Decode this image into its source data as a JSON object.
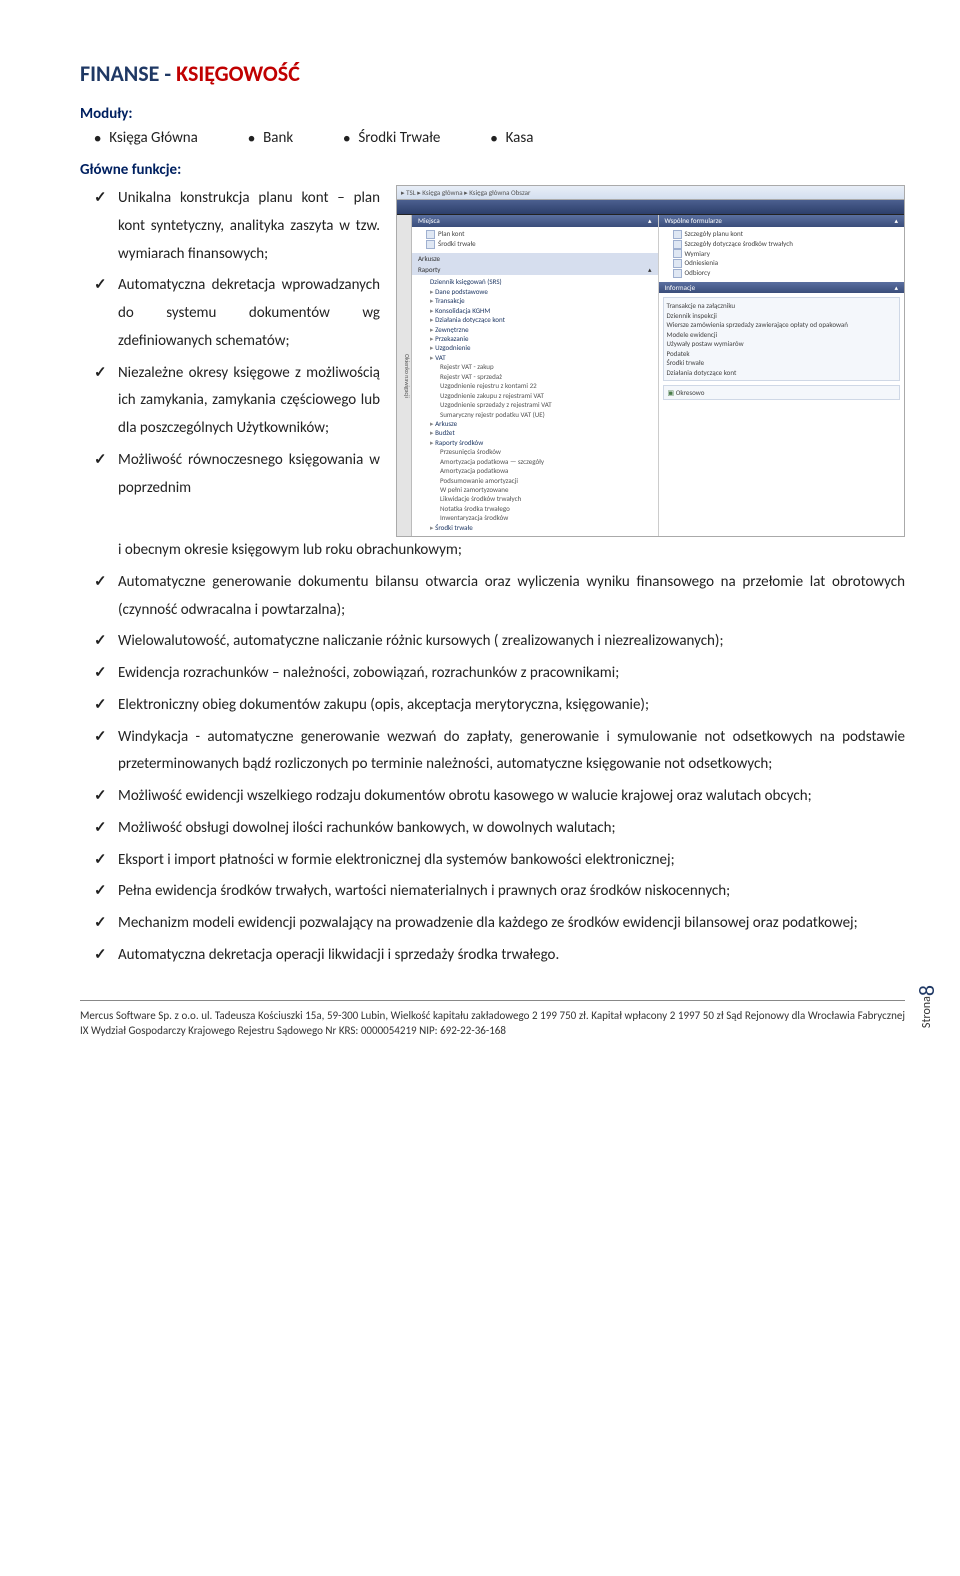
{
  "title_part1": "FINANSE - ",
  "title_part2": "KSIĘGOWOŚĆ",
  "label_moduly": "Moduły:",
  "modules": [
    "Księga Główna",
    "Bank",
    "Środki Trwałe",
    "Kasa"
  ],
  "label_funkcje": "Główne funkcje:",
  "left_features": [
    "Unikalna konstrukcja planu kont – plan kont syntetyczny, analityka zaszyta w tzw. wymiarach finansowych;",
    "Automatyczna dekretacja wprowadzanych do systemu dokumentów wg zdefiniowanych schematów;",
    "Niezależne okresy księgowe z możliwością ich zamykania, zamykania częściowego lub dla poszczególnych Użytkowników;",
    "Możliwość równoczesnego księgowania w poprzednim"
  ],
  "full_features": [
    "i obecnym okresie księgowym lub roku obrachunkowym;",
    "Automatyczne generowanie dokumentu bilansu otwarcia oraz wyliczenia wyniku finansowego na przełomie lat obrotowych (czynność odwracalna i powtarzalna);",
    "Wielowalutowość, automatyczne naliczanie różnic kursowych ( zrealizowanych i niezrealizowanych);",
    "Ewidencja rozrachunków – należności, zobowiązań, rozrachunków z pracownikami;",
    "Elektroniczny obieg dokumentów zakupu (opis, akceptacja merytoryczna, księgowanie);",
    "Windykacja - automatyczne generowanie wezwań do zapłaty, generowanie i symulowanie not odsetkowych na podstawie przeterminowanych bądź rozliczonych po terminie należności, automatyczne księgowanie not odsetkowych;",
    "Możliwość ewidencji wszelkiego rodzaju dokumentów obrotu kasowego w walucie krajowej oraz walutach obcych;",
    "Możliwość obsługi dowolnej ilości rachunków bankowych, w dowolnych walutach;",
    "Eksport i import płatności w formie elektronicznej dla systemów bankowości elektronicznej;",
    "Pełna ewidencja środków trwałych, wartości niematerialnych i prawnych oraz środków niskocennych;",
    "Mechanizm modeli ewidencji pozwalający na prowadzenie dla każdego ze środków ewidencji bilansowej oraz podatkowej;",
    "Automatyczna dekretacja operacji likwidacji i sprzedaży środka trwałego."
  ],
  "shot": {
    "breadcrumb": "▸ TSL ▸ Księga główna ▸ Księga główna Obszar",
    "tab": "Okienko nawigacji",
    "col1": {
      "hdr": "Miejsca",
      "items": [
        "Plan kont",
        "Środki trwałe"
      ],
      "arkusze": "Arkusze",
      "raporty": "Raporty",
      "tree": [
        {
          "t": "Dziennik księgowań (SRS)",
          "lvl": 1
        },
        {
          "t": "Dane podstawowe",
          "lvl": 1,
          "doc": true
        },
        {
          "t": "Transakcje",
          "lvl": 1,
          "doc": true
        },
        {
          "t": "Konsolidacja KGHM",
          "lvl": 1,
          "doc": true
        },
        {
          "t": "Działania dotyczące kont",
          "lvl": 1,
          "doc": true
        },
        {
          "t": "Zewnętrzne",
          "lvl": 1,
          "doc": true
        },
        {
          "t": "Przekazanie",
          "lvl": 1,
          "doc": true
        },
        {
          "t": "Uzgodnienie",
          "lvl": 1,
          "doc": true
        },
        {
          "t": "VAT",
          "lvl": 1,
          "doc": true
        },
        {
          "t": "Rejestr VAT - zakup",
          "lvl": 2
        },
        {
          "t": "Rejestr VAT - sprzedaż",
          "lvl": 2
        },
        {
          "t": "Uzgodnienie rejestru z kontami 22",
          "lvl": 2
        },
        {
          "t": "Uzgodnienie zakupu z rejestrami VAT",
          "lvl": 2
        },
        {
          "t": "Uzgodnienie sprzedaży z rejestrami VAT",
          "lvl": 2
        },
        {
          "t": "Sumaryczny rejestr podatku VAT (UE)",
          "lvl": 2
        },
        {
          "t": "Arkusze",
          "lvl": 1,
          "doc": true
        },
        {
          "t": "Budżet",
          "lvl": 1,
          "doc": true
        },
        {
          "t": "Raporty środków",
          "lvl": 1,
          "doc": true
        },
        {
          "t": "Przesunięcia środków",
          "lvl": 2
        },
        {
          "t": "Amortyzacja podatkowa — szczegóły",
          "lvl": 2
        },
        {
          "t": "Amortyzacja podatkowa",
          "lvl": 2
        },
        {
          "t": "Podsumowanie amortyzacji",
          "lvl": 2
        },
        {
          "t": "W pełni zamortyzowane",
          "lvl": 2
        },
        {
          "t": "Likwidacje środków trwałych",
          "lvl": 2
        },
        {
          "t": "Notatka środka trwałego",
          "lvl": 2
        },
        {
          "t": "Inwentaryzacja środków",
          "lvl": 2
        },
        {
          "t": "Środki trwałe",
          "lvl": 1,
          "doc": true
        }
      ]
    },
    "col2": {
      "hdr": "Wspólne formularze",
      "items": [
        "Szczegóły planu kont",
        "Szczegóły dotyczące środków trwałych",
        "Wymiary",
        "Odniesienia",
        "Odbiorcy"
      ],
      "info_hdr": "Informacje",
      "info": [
        "Transakcje na załączniku",
        "Dziennik inspekcji",
        "Wiersze zamówienia sprzedaży zawierające opłaty od opakowań",
        "Modele ewidencji",
        "Używały postaw wymiarów",
        "Podatek",
        "Środki trwałe",
        "Działania dotyczące kont"
      ],
      "okresowo": "Okresowo"
    }
  },
  "footer": "Mercus Software Sp. z o.o. ul. Tadeusza Kościuszki 15a, 59-300 Lubin, Wielkość kapitału zakładowego 2 199 750 zł. Kapitał wpłacony 2 1997 50 zł Sąd Rejonowy dla Wrocławia Fabrycznej IX Wydział Gospodarczy Krajowego Rejestru Sądowego Nr KRS: 0000054219 NIP: 692-22-36-168",
  "strona_label": "Strona",
  "strona_num": "8"
}
